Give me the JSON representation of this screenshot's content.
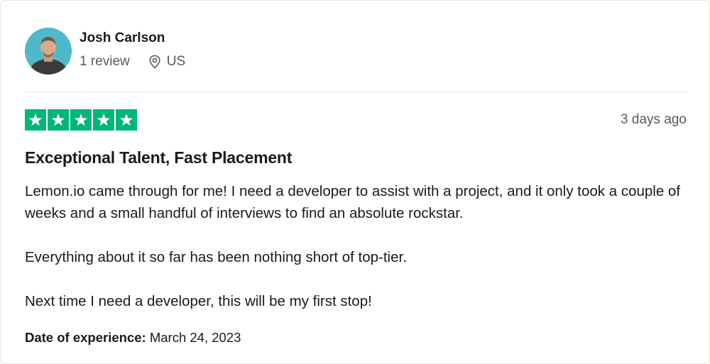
{
  "reviewer": {
    "name": "Josh Carlson",
    "review_count": "1 review",
    "location": "US",
    "location_icon": "location-pin-icon"
  },
  "review": {
    "rating": 5,
    "max_rating": 5,
    "star_color": "#00b67a",
    "posted": "3 days ago",
    "title": "Exceptional Talent, Fast Placement",
    "paragraphs": [
      "Lemon.io came through for me! I need a developer to assist with a project, and it only took a couple of weeks and a small handful of interviews to find an absolute rockstar.",
      "Everything about it so far has been nothing short of top-tier.",
      "Next time I need a developer, this will be my first stop!"
    ],
    "experience_label": "Date of experience:",
    "experience_date": "March 24, 2023"
  }
}
